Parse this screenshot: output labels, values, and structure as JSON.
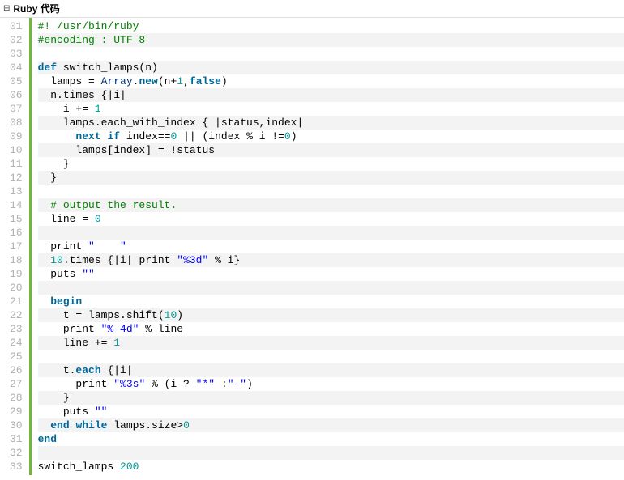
{
  "header": {
    "title": "Ruby 代码",
    "collapse_glyph": "⊟"
  },
  "code": {
    "lines": [
      {
        "n": "01",
        "alt": false,
        "tokens": [
          {
            "cls": "c-comment",
            "t": "#! /usr/bin/ruby"
          }
        ]
      },
      {
        "n": "02",
        "alt": true,
        "tokens": [
          {
            "cls": "c-comment",
            "t": "#encoding : UTF-8"
          }
        ]
      },
      {
        "n": "03",
        "alt": false,
        "tokens": [
          {
            "cls": "c-plain",
            "t": " "
          }
        ]
      },
      {
        "n": "04",
        "alt": true,
        "tokens": [
          {
            "cls": "c-keyword",
            "t": "def"
          },
          {
            "cls": "c-plain",
            "t": " switch_lamps(n)"
          }
        ]
      },
      {
        "n": "05",
        "alt": false,
        "tokens": [
          {
            "cls": "c-plain",
            "t": "  lamps = "
          },
          {
            "cls": "c-builtin",
            "t": "Array"
          },
          {
            "cls": "c-plain",
            "t": "."
          },
          {
            "cls": "c-keyword",
            "t": "new"
          },
          {
            "cls": "c-plain",
            "t": "(n+"
          },
          {
            "cls": "c-number",
            "t": "1"
          },
          {
            "cls": "c-plain",
            "t": ","
          },
          {
            "cls": "c-keyword",
            "t": "false"
          },
          {
            "cls": "c-plain",
            "t": ")"
          }
        ]
      },
      {
        "n": "06",
        "alt": true,
        "tokens": [
          {
            "cls": "c-plain",
            "t": "  n.times {|i|"
          }
        ]
      },
      {
        "n": "07",
        "alt": false,
        "tokens": [
          {
            "cls": "c-plain",
            "t": "    i += "
          },
          {
            "cls": "c-number",
            "t": "1"
          }
        ]
      },
      {
        "n": "08",
        "alt": true,
        "tokens": [
          {
            "cls": "c-plain",
            "t": "    lamps.each_with_index { |status,index|"
          }
        ]
      },
      {
        "n": "09",
        "alt": false,
        "tokens": [
          {
            "cls": "c-plain",
            "t": "      "
          },
          {
            "cls": "c-keyword",
            "t": "next"
          },
          {
            "cls": "c-plain",
            "t": " "
          },
          {
            "cls": "c-keyword",
            "t": "if"
          },
          {
            "cls": "c-plain",
            "t": " index=="
          },
          {
            "cls": "c-number",
            "t": "0"
          },
          {
            "cls": "c-plain",
            "t": " || (index % i !="
          },
          {
            "cls": "c-number",
            "t": "0"
          },
          {
            "cls": "c-plain",
            "t": ")"
          }
        ]
      },
      {
        "n": "10",
        "alt": true,
        "tokens": [
          {
            "cls": "c-plain",
            "t": "      lamps[index] = !status"
          }
        ]
      },
      {
        "n": "11",
        "alt": false,
        "tokens": [
          {
            "cls": "c-plain",
            "t": "    }"
          }
        ]
      },
      {
        "n": "12",
        "alt": true,
        "tokens": [
          {
            "cls": "c-plain",
            "t": "  }"
          }
        ]
      },
      {
        "n": "13",
        "alt": false,
        "tokens": [
          {
            "cls": "c-plain",
            "t": " "
          }
        ]
      },
      {
        "n": "14",
        "alt": true,
        "tokens": [
          {
            "cls": "c-plain",
            "t": "  "
          },
          {
            "cls": "c-comment",
            "t": "# output the result."
          }
        ]
      },
      {
        "n": "15",
        "alt": false,
        "tokens": [
          {
            "cls": "c-plain",
            "t": "  line = "
          },
          {
            "cls": "c-number",
            "t": "0"
          }
        ]
      },
      {
        "n": "16",
        "alt": true,
        "tokens": [
          {
            "cls": "c-plain",
            "t": " "
          }
        ]
      },
      {
        "n": "17",
        "alt": false,
        "tokens": [
          {
            "cls": "c-plain",
            "t": "  print "
          },
          {
            "cls": "c-string",
            "t": "\"    \""
          }
        ]
      },
      {
        "n": "18",
        "alt": true,
        "tokens": [
          {
            "cls": "c-plain",
            "t": "  "
          },
          {
            "cls": "c-number",
            "t": "10"
          },
          {
            "cls": "c-plain",
            "t": ".times {|i| print "
          },
          {
            "cls": "c-string",
            "t": "\"%3d\""
          },
          {
            "cls": "c-plain",
            "t": " % i}"
          }
        ]
      },
      {
        "n": "19",
        "alt": false,
        "tokens": [
          {
            "cls": "c-plain",
            "t": "  puts "
          },
          {
            "cls": "c-string",
            "t": "\"\""
          }
        ]
      },
      {
        "n": "20",
        "alt": true,
        "tokens": [
          {
            "cls": "c-plain",
            "t": " "
          }
        ]
      },
      {
        "n": "21",
        "alt": false,
        "tokens": [
          {
            "cls": "c-plain",
            "t": "  "
          },
          {
            "cls": "c-keyword",
            "t": "begin"
          }
        ]
      },
      {
        "n": "22",
        "alt": true,
        "tokens": [
          {
            "cls": "c-plain",
            "t": "    t = lamps.shift("
          },
          {
            "cls": "c-number",
            "t": "10"
          },
          {
            "cls": "c-plain",
            "t": ")"
          }
        ]
      },
      {
        "n": "23",
        "alt": false,
        "tokens": [
          {
            "cls": "c-plain",
            "t": "    print "
          },
          {
            "cls": "c-string",
            "t": "\"%-4d\""
          },
          {
            "cls": "c-plain",
            "t": " % line"
          }
        ]
      },
      {
        "n": "24",
        "alt": true,
        "tokens": [
          {
            "cls": "c-plain",
            "t": "    line += "
          },
          {
            "cls": "c-number",
            "t": "1"
          }
        ]
      },
      {
        "n": "25",
        "alt": false,
        "tokens": [
          {
            "cls": "c-plain",
            "t": " "
          }
        ]
      },
      {
        "n": "26",
        "alt": true,
        "tokens": [
          {
            "cls": "c-plain",
            "t": "    t."
          },
          {
            "cls": "c-keyword",
            "t": "each"
          },
          {
            "cls": "c-plain",
            "t": " {|i|"
          }
        ]
      },
      {
        "n": "27",
        "alt": false,
        "tokens": [
          {
            "cls": "c-plain",
            "t": "      print "
          },
          {
            "cls": "c-string",
            "t": "\"%3s\""
          },
          {
            "cls": "c-plain",
            "t": " % (i ? "
          },
          {
            "cls": "c-string",
            "t": "\"*\""
          },
          {
            "cls": "c-plain",
            "t": " :"
          },
          {
            "cls": "c-string",
            "t": "\"-\""
          },
          {
            "cls": "c-plain",
            "t": ")"
          }
        ]
      },
      {
        "n": "28",
        "alt": true,
        "tokens": [
          {
            "cls": "c-plain",
            "t": "    }"
          }
        ]
      },
      {
        "n": "29",
        "alt": false,
        "tokens": [
          {
            "cls": "c-plain",
            "t": "    puts "
          },
          {
            "cls": "c-string",
            "t": "\"\""
          }
        ]
      },
      {
        "n": "30",
        "alt": true,
        "tokens": [
          {
            "cls": "c-plain",
            "t": "  "
          },
          {
            "cls": "c-keyword",
            "t": "end"
          },
          {
            "cls": "c-plain",
            "t": " "
          },
          {
            "cls": "c-keyword",
            "t": "while"
          },
          {
            "cls": "c-plain",
            "t": " lamps.size>"
          },
          {
            "cls": "c-number",
            "t": "0"
          }
        ]
      },
      {
        "n": "31",
        "alt": false,
        "tokens": [
          {
            "cls": "c-keyword",
            "t": "end"
          }
        ]
      },
      {
        "n": "32",
        "alt": true,
        "tokens": [
          {
            "cls": "c-plain",
            "t": " "
          }
        ]
      },
      {
        "n": "33",
        "alt": false,
        "tokens": [
          {
            "cls": "c-plain",
            "t": "switch_lamps "
          },
          {
            "cls": "c-number",
            "t": "200"
          }
        ]
      }
    ]
  }
}
